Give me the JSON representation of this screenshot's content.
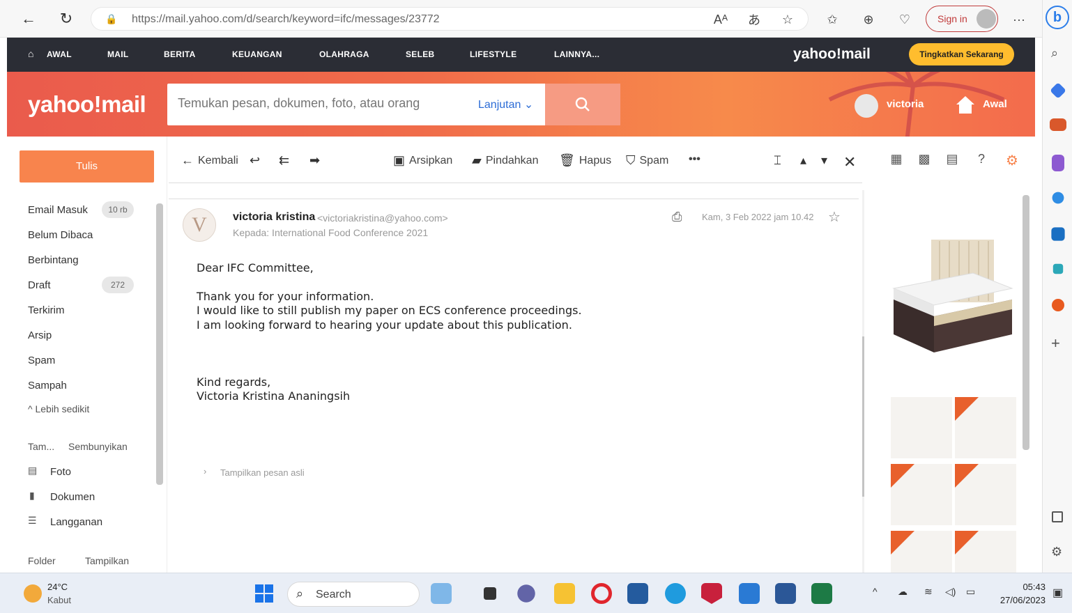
{
  "browser": {
    "url": "https://mail.yahoo.com/d/search/keyword=ifc/messages/23772",
    "signin_label": "Sign in"
  },
  "yahoo_nav": {
    "items": [
      "AWAL",
      "MAIL",
      "BERITA",
      "KEUANGAN",
      "OLAHRAGA",
      "SELEB",
      "LIFESTYLE",
      "LAINNYA..."
    ],
    "logo": "yahoo!mail",
    "upgrade_label": "Tingkatkan Sekarang"
  },
  "header": {
    "logo": "yahoo!mail",
    "search_placeholder": "Temukan pesan, dokumen, foto, atau orang",
    "search_advanced": "Lanjutan",
    "user_name": "victoria",
    "home_label": "Awal"
  },
  "sidebar": {
    "compose_label": "Tulis",
    "folders": [
      {
        "label": "Email Masuk",
        "badge": "10 rb"
      },
      {
        "label": "Belum Dibaca",
        "badge": ""
      },
      {
        "label": "Berbintang",
        "badge": ""
      },
      {
        "label": "Draft",
        "badge": "272"
      },
      {
        "label": "Terkirim",
        "badge": ""
      },
      {
        "label": "Arsip",
        "badge": ""
      },
      {
        "label": "Spam",
        "badge": ""
      },
      {
        "label": "Sampah",
        "badge": ""
      }
    ],
    "less_label": "^ Lebih sedikit",
    "views_label": "Tam...",
    "hide_label": "Sembunyikan",
    "views": [
      "Foto",
      "Dokumen",
      "Langganan"
    ],
    "folder_label": "Folder",
    "show_label": "Tampilkan"
  },
  "toolbar": {
    "back": "Kembali",
    "archive": "Arsipkan",
    "move": "Pindahkan",
    "delete": "Hapus",
    "spam": "Spam",
    "more": "•••"
  },
  "message": {
    "sender_name": "victoria kristina",
    "sender_email": "<victoriakristina@yahoo.com>",
    "recipient": "Kepada: International Food Conference 2021",
    "date": "Kam, 3 Feb 2022 jam 10.42",
    "body": [
      "Dear IFC Committee,",
      "Thank you for your information.",
      "I would like to still publish my paper on ECS conference proceedings.",
      "I am looking forward to hearing your update about this publication.",
      "Kind regards,",
      "Victoria Kristina Ananingsih"
    ],
    "show_original": "Tampilkan pesan asli",
    "avatar_letter": "V"
  },
  "taskbar": {
    "temp": "24°C",
    "weather": "Kabut",
    "search_label": "Search",
    "time": "05:43",
    "date": "27/06/2023"
  },
  "colors": {
    "nav_bg": "#2b2d35",
    "accent_orange": "#f8844d",
    "link_blue": "#2c6cd6",
    "upgrade_yellow": "#ffbd2e"
  }
}
